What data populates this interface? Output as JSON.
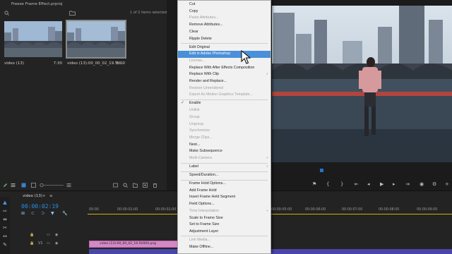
{
  "project": {
    "title": "Freeze Frame Effect.prproj",
    "items_status": "1 of 2 items selected",
    "clips": [
      {
        "name": "video (13)",
        "duration": "7:30"
      },
      {
        "name": "video (13):00_00_02_19.5tl...",
        "duration": "5:00"
      }
    ]
  },
  "menu": {
    "items": [
      {
        "label": "Cut",
        "disabled": false
      },
      {
        "label": "Copy",
        "disabled": false
      },
      {
        "label": "Paste Attributes...",
        "disabled": true
      },
      {
        "label": "Remove Attributes...",
        "disabled": false
      },
      {
        "label": "Clear",
        "disabled": false
      },
      {
        "label": "Ripple Delete",
        "disabled": false
      },
      {
        "label": "Edit Original",
        "disabled": false
      },
      {
        "label": "Edit in Adobe Photoshop",
        "disabled": false,
        "highlighted": true
      },
      {
        "label": "License...",
        "disabled": true
      },
      {
        "label": "Replace With After Effects Composition",
        "disabled": false
      },
      {
        "label": "Replace With Clip",
        "disabled": false,
        "submenu": true
      },
      {
        "label": "Render and Replace...",
        "disabled": false
      },
      {
        "label": "Restore Unrendered",
        "disabled": true
      },
      {
        "label": "Export As Motion Graphics Template...",
        "disabled": true
      },
      {
        "label": "Enable",
        "disabled": false,
        "checked": true
      },
      {
        "label": "Unlink",
        "disabled": true
      },
      {
        "label": "Group",
        "disabled": true
      },
      {
        "label": "Ungroup",
        "disabled": true
      },
      {
        "label": "Synchronize",
        "disabled": true
      },
      {
        "label": "Merge Clips...",
        "disabled": true
      },
      {
        "label": "Nest...",
        "disabled": false
      },
      {
        "label": "Make Subsequence",
        "disabled": false
      },
      {
        "label": "Multi-Camera",
        "disabled": true,
        "submenu": true
      },
      {
        "label": "Label",
        "disabled": false,
        "submenu": true
      },
      {
        "label": "Speed/Duration...",
        "disabled": false
      },
      {
        "label": "Frame Hold Options...",
        "disabled": false
      },
      {
        "label": "Add Frame Hold",
        "disabled": false
      },
      {
        "label": "Insert Frame Hold Segment",
        "disabled": false
      },
      {
        "label": "Field Options...",
        "disabled": false
      },
      {
        "label": "Time Interpolation",
        "disabled": true,
        "submenu": true
      },
      {
        "label": "Scale to Frame Size",
        "disabled": false
      },
      {
        "label": "Set to Frame Size",
        "disabled": false
      },
      {
        "label": "Adjustment Layer",
        "disabled": false
      },
      {
        "label": "Link Media...",
        "disabled": true
      },
      {
        "label": "Make Offline...",
        "disabled": false
      }
    ]
  },
  "timeline": {
    "sequence_name": "video (13)",
    "timecode": "00:00:02:19",
    "ruler_ticks": [
      "00:00",
      "00:00:01:00",
      "00:00:02:00",
      "00:00:05:00",
      "00:00:06:00",
      "00:00:07:00",
      "00:00:08:00",
      "00:00:09:00"
    ],
    "track_v1": "V1",
    "clip_label": "video (13):00_00_02_19.5tl004.png"
  },
  "colors": {
    "accent": "#2a71c9",
    "highlight": "#4a8fd9",
    "timecode": "#2a8fe0",
    "clip_pink": "#d489c4"
  }
}
